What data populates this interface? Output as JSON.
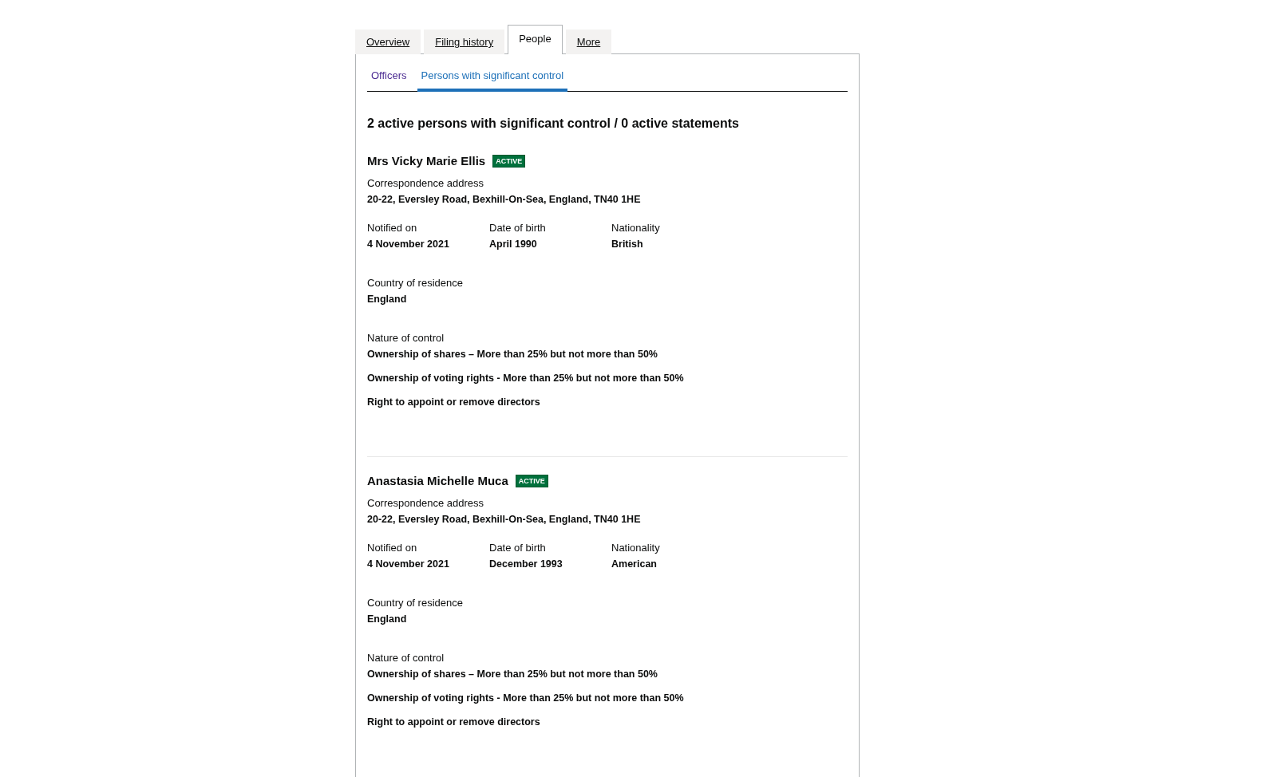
{
  "tabs": [
    {
      "label": "Overview",
      "selected": false
    },
    {
      "label": "Filing history",
      "selected": false
    },
    {
      "label": "People",
      "selected": true
    },
    {
      "label": "More",
      "selected": false
    }
  ],
  "subtabs": [
    {
      "label": "Officers",
      "selected": false,
      "visited": true
    },
    {
      "label": "Persons with significant control",
      "selected": true,
      "visited": false
    }
  ],
  "heading": "2 active persons with significant control / 0 active statements",
  "persons": [
    {
      "name": "Mrs Vicky Marie Ellis",
      "status": "ACTIVE",
      "address_label": "Correspondence address",
      "address": "20-22, Eversley Road, Bexhill-On-Sea, England, TN40 1HE",
      "details": [
        {
          "label": "Notified on",
          "value": "4 November 2021"
        },
        {
          "label": "Date of birth",
          "value": "April 1990"
        },
        {
          "label": "Nationality",
          "value": "British"
        }
      ],
      "residence": {
        "label": "Country of residence",
        "value": "England"
      },
      "control": {
        "label": "Nature of control",
        "items": [
          "Ownership of shares – More than 25% but not more than 50%",
          "Ownership of voting rights - More than 25% but not more than 50%",
          "Right to appoint or remove directors"
        ]
      }
    },
    {
      "name": "Anastasia Michelle Muca",
      "status": "ACTIVE",
      "address_label": "Correspondence address",
      "address": "20-22, Eversley Road, Bexhill-On-Sea, England, TN40 1HE",
      "details": [
        {
          "label": "Notified on",
          "value": "4 November 2021"
        },
        {
          "label": "Date of birth",
          "value": "December 1993"
        },
        {
          "label": "Nationality",
          "value": "American"
        }
      ],
      "residence": {
        "label": "Country of residence",
        "value": "England"
      },
      "control": {
        "label": "Nature of control",
        "items": [
          "Ownership of shares – More than 25% but not more than 50%",
          "Ownership of voting rights - More than 25% but not more than 50%",
          "Right to appoint or remove directors"
        ]
      }
    }
  ]
}
